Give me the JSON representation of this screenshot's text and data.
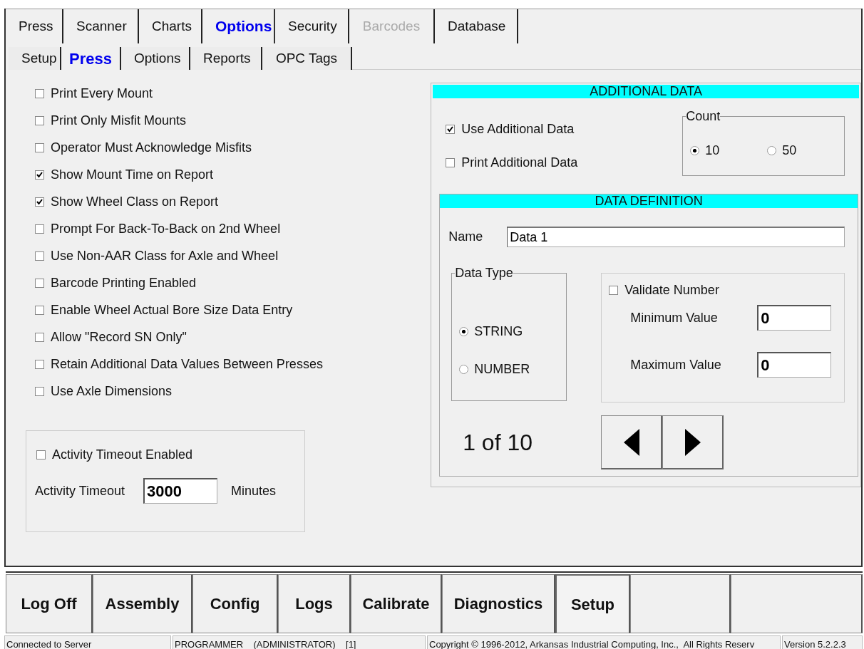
{
  "tabs": [
    {
      "label": "Press",
      "selected": false,
      "disabled": false
    },
    {
      "label": "Scanner",
      "selected": false,
      "disabled": false
    },
    {
      "label": "Charts",
      "selected": false,
      "disabled": false
    },
    {
      "label": "Options",
      "selected": true,
      "disabled": false
    },
    {
      "label": "Security",
      "selected": false,
      "disabled": false
    },
    {
      "label": "Barcodes",
      "selected": false,
      "disabled": true
    },
    {
      "label": "Database",
      "selected": false,
      "disabled": false
    }
  ],
  "subtabs": [
    {
      "label": "Setup",
      "selected": false
    },
    {
      "label": "Press",
      "selected": true
    },
    {
      "label": "Options",
      "selected": false
    },
    {
      "label": "Reports",
      "selected": false
    },
    {
      "label": "OPC Tags",
      "selected": false
    }
  ],
  "options": [
    {
      "label": "Print Every Mount",
      "checked": false
    },
    {
      "label": "Print Only Misfit Mounts",
      "checked": false
    },
    {
      "label": "Operator Must Acknowledge Misfits",
      "checked": false
    },
    {
      "label": "Show Mount Time on Report",
      "checked": true
    },
    {
      "label": "Show Wheel Class on Report",
      "checked": true
    },
    {
      "label": "Prompt For Back-To-Back on 2nd Wheel",
      "checked": false
    },
    {
      "label": "Use Non-AAR Class for Axle and Wheel",
      "checked": false
    },
    {
      "label": "Barcode Printing Enabled",
      "checked": false
    },
    {
      "label": "Enable Wheel Actual Bore Size Data Entry",
      "checked": false
    },
    {
      "label": "Allow \"Record SN Only\"",
      "checked": false
    },
    {
      "label": "Retain Additional Data Values Between Presses",
      "checked": false
    },
    {
      "label": "Use Axle Dimensions",
      "checked": false
    }
  ],
  "timeout": {
    "enabled": {
      "label": "Activity Timeout Enabled",
      "checked": false
    },
    "label": "Activity Timeout",
    "value": "3000",
    "unit": "Minutes"
  },
  "additional_data": {
    "title": "ADDITIONAL DATA",
    "checks": [
      {
        "label": "Use Additional Data",
        "checked": true
      },
      {
        "label": "Print Additional Data",
        "checked": false
      }
    ],
    "count": {
      "title": "Count",
      "options": [
        {
          "label": "10",
          "selected": true
        },
        {
          "label": "50",
          "selected": false
        }
      ]
    },
    "definition": {
      "title": "DATA DEFINITION",
      "name_label": "Name",
      "name_value": "Data 1",
      "data_type": {
        "title": "Data Type",
        "options": [
          {
            "label": "STRING",
            "selected": true
          },
          {
            "label": "NUMBER",
            "selected": false
          }
        ]
      },
      "validate": {
        "label": "Validate Number",
        "checked": false
      },
      "min_label": "Minimum Value",
      "min_value": "0",
      "max_label": "Maximum Value",
      "max_value": "0",
      "position": "1 of 10"
    }
  },
  "bottom_buttons": [
    {
      "label": "Log Off",
      "selected": false
    },
    {
      "label": "Assembly",
      "selected": false
    },
    {
      "label": "Config",
      "selected": false
    },
    {
      "label": "Logs",
      "selected": false
    },
    {
      "label": "Calibrate",
      "selected": false
    },
    {
      "label": "Diagnostics",
      "selected": false
    },
    {
      "label": "Setup",
      "selected": true
    }
  ],
  "status_bar": [
    "Connected to Server",
    "PROGRAMMER    (ADMINISTRATOR)    [1]",
    "Copyright © 1996-2012, Arkansas Industrial Computing, Inc.,  All Rights Reserv",
    "Version 5.2.2.3"
  ]
}
